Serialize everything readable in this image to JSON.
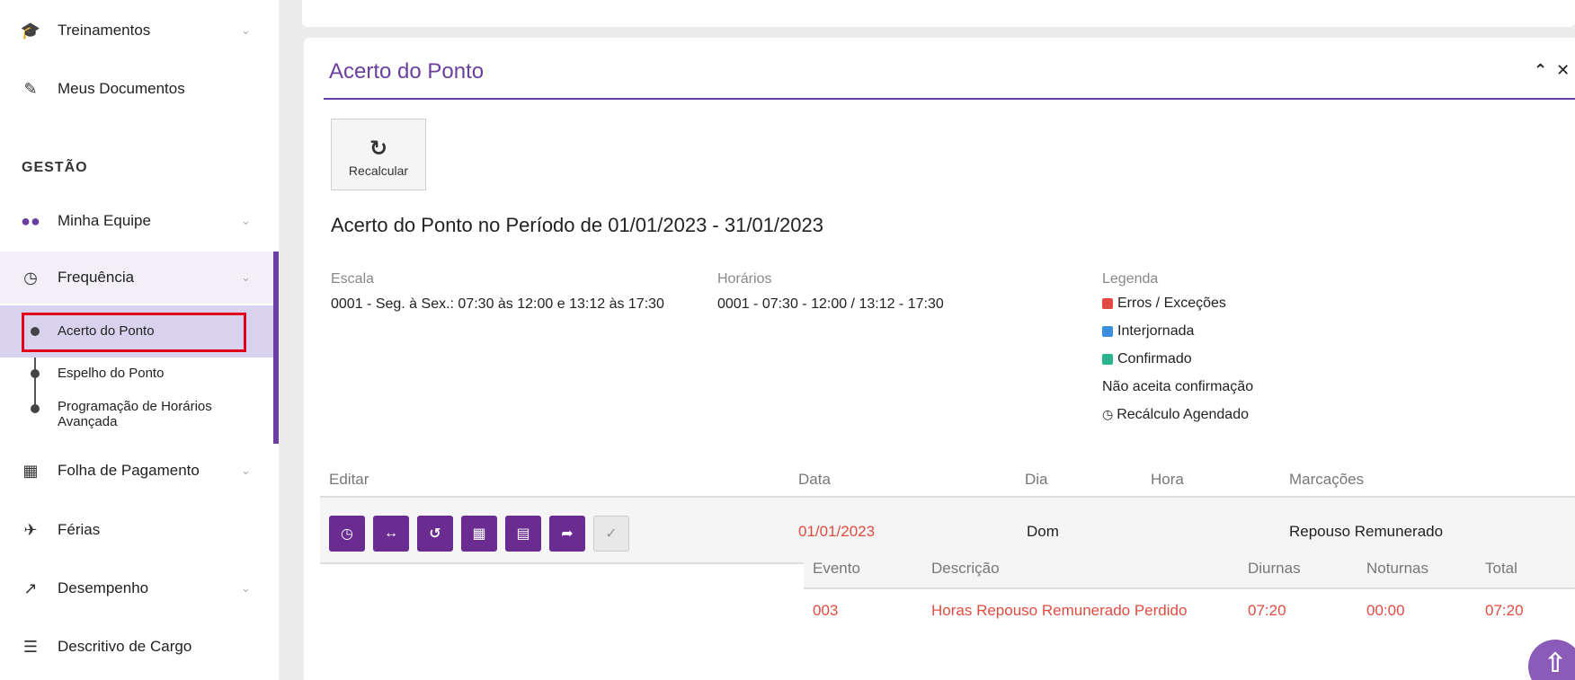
{
  "sidebar": {
    "items": [
      {
        "label": "Treinamentos",
        "icon": "graduation-cap-icon"
      },
      {
        "label": "Meus Documentos",
        "icon": "edit-document-icon"
      },
      {
        "label": "Minha Equipe",
        "icon": "users-icon"
      },
      {
        "label": "Frequência",
        "icon": "clock-icon"
      },
      {
        "label": "Folha de Pagamento",
        "icon": "calculator-icon"
      },
      {
        "label": "Férias",
        "icon": "plane-icon"
      },
      {
        "label": "Desempenho",
        "icon": "line-chart-icon"
      },
      {
        "label": "Descritivo de Cargo",
        "icon": "list-icon"
      }
    ],
    "section_title": "GESTÃO",
    "frequencia_sub": [
      {
        "label": "Acerto do Ponto"
      },
      {
        "label": "Espelho do Ponto"
      },
      {
        "label": "Programação de Horários Avançada"
      }
    ]
  },
  "panel": {
    "title": "Acerto do Ponto",
    "recalc_label": "Recalcular",
    "period_title": "Acerto do Ponto no Período de 01/01/2023 - 31/01/2023",
    "escala_label": "Escala",
    "escala_value": "0001 - Seg. à Sex.: 07:30 às 12:00 e 13:12 às 17:30",
    "horarios_label": "Horários",
    "horarios_value": "0001 - 07:30 - 12:00 / 13:12 - 17:30",
    "legenda_label": "Legenda",
    "legend": [
      {
        "label": "Erros / Exceções",
        "color": "#e24b40"
      },
      {
        "label": "Interjornada",
        "color": "#3b8fdc"
      },
      {
        "label": "Confirmado",
        "color": "#2ab58f"
      },
      {
        "label": "Não aceita confirmação",
        "color": ""
      },
      {
        "label": "Recálculo Agendado",
        "color": ""
      }
    ]
  },
  "table": {
    "headers": {
      "editar": "Editar",
      "data": "Data",
      "dia": "Dia",
      "hora": "Hora",
      "marcacoes": "Marcações"
    },
    "row": {
      "data": "01/01/2023",
      "dia": "Dom",
      "marcacoes": "Repouso Remunerado"
    },
    "sub_headers": {
      "evento": "Evento",
      "descricao": "Descrição",
      "diurnas": "Diurnas",
      "noturnas": "Noturnas",
      "total": "Total"
    },
    "sub_row": {
      "evento": "003",
      "descricao": "Horas Repouso Remunerado Perdido",
      "diurnas": "07:20",
      "noturnas": "00:00",
      "total": "07:20"
    }
  },
  "colors": {
    "accent": "#6b3fa0",
    "error": "#e24b40"
  }
}
